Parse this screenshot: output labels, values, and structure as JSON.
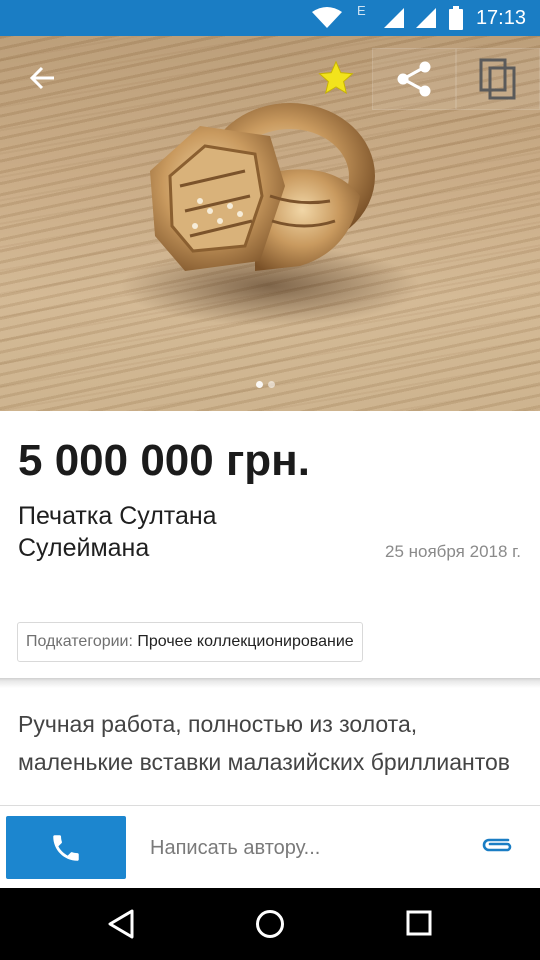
{
  "status_bar": {
    "time": "17:13",
    "network_label": "E",
    "icons": [
      "wifi-icon",
      "signal-icon",
      "signal-icon",
      "battery-icon"
    ]
  },
  "gallery": {
    "icons": [
      "back-arrow-icon",
      "star-icon",
      "share-icon",
      "copy-icon"
    ],
    "page_count": 2,
    "active_page": 1
  },
  "listing": {
    "price": "5 000 000 грн.",
    "title": "Печатка Султана Сулеймана",
    "date": "25 ноября 2018 г.",
    "subcategory_label": "Подкатегории:",
    "subcategory_value": "Прочее коллекционирование",
    "description": "Ручная работа, полностью из золота, маленькие вставки малазийских бриллиантов"
  },
  "bottom_bar": {
    "message_placeholder": "Написать автору...",
    "icons": [
      "phone-icon",
      "paperclip-icon"
    ]
  },
  "colors": {
    "status_bar": "#1a7dc4",
    "call_button": "#1c86cf",
    "star": "#f2e31c",
    "accent": "#1a7dc4"
  },
  "nav_bar": {
    "icons": [
      "back-icon",
      "home-icon",
      "recents-icon"
    ]
  }
}
